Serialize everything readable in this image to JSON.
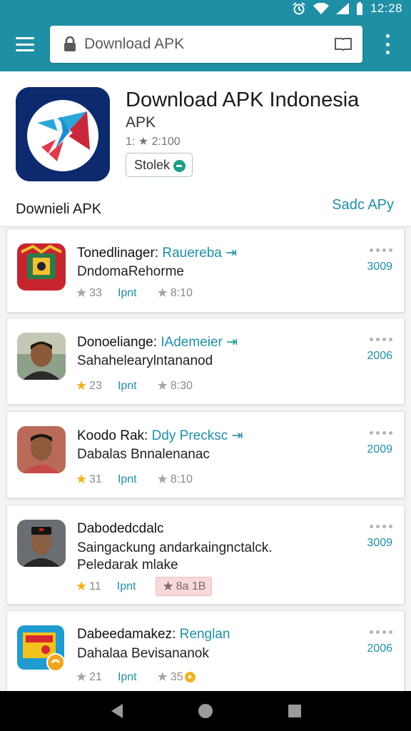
{
  "status_bar": {
    "time": "12:28"
  },
  "browser": {
    "url_text": "Download APK"
  },
  "app": {
    "title": "Download APK Indonesia",
    "subtitle": "APK",
    "rating": "1: ★ 2:100",
    "button_label": "Stolek"
  },
  "section": {
    "label": "Downieli APK",
    "link": "Sadc APy"
  },
  "items": [
    {
      "title": "Tonedlinager:",
      "title_accent": "Rauereba",
      "desc_lines": [
        "DndomaRehorme"
      ],
      "rating": "33",
      "rating_star": "grey",
      "label": "Ipnt",
      "tag": "8:10",
      "count": "3009"
    },
    {
      "title": "Donoeliange:",
      "title_accent": "IAdemeier",
      "desc_lines": [
        "Sahahelearylntananod"
      ],
      "rating": "23",
      "rating_star": "gold",
      "label": "Ipnt",
      "tag": "8:30",
      "count": "2006"
    },
    {
      "title": "Koodo Rak:",
      "title_accent": "Ddy Precksc",
      "desc_lines": [
        "Dabalas Bnnalenanac"
      ],
      "rating": "31",
      "rating_star": "gold",
      "label": "Ipnt",
      "tag": "8:10",
      "count": "2009"
    },
    {
      "title": "Dabodedcdalc",
      "title_accent": "",
      "desc_lines": [
        "Saingackung andarkaingnctalck.",
        "Peledarak mlake"
      ],
      "rating": "11",
      "rating_star": "gold",
      "label": "Ipnt",
      "tag": "8a 1B",
      "count": "3009"
    },
    {
      "title": "Dabeedamakez:",
      "title_accent": "Renglan",
      "desc_lines": [
        "Dahalaa Bevisananok"
      ],
      "rating": "21",
      "rating_star": "grey",
      "label": "Ipnt",
      "tag": "35",
      "count": "2006"
    }
  ]
}
